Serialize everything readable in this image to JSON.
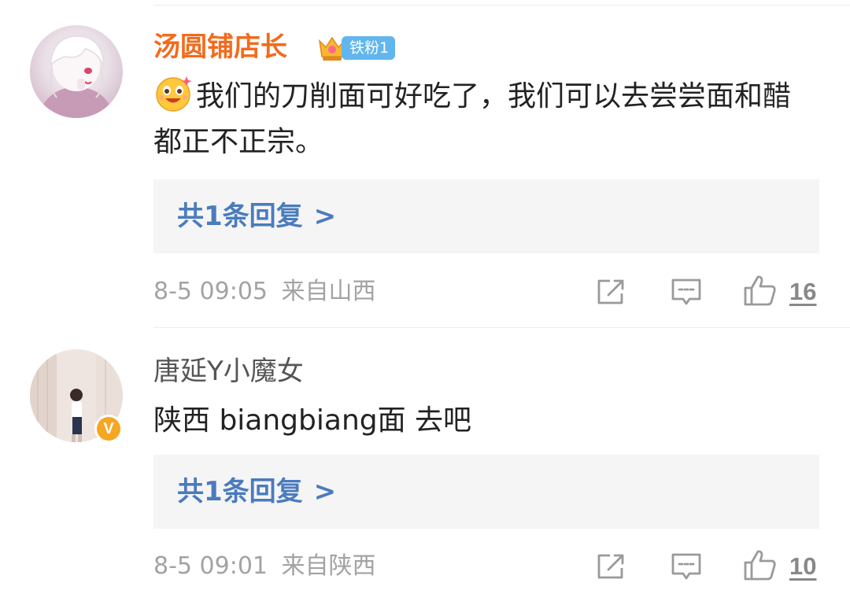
{
  "comments": [
    {
      "username": "汤圆铺店长",
      "fan_badge": "铁粉1",
      "content": "我们的刀削面可好吃了，我们可以去尝尝面和醋都正不正宗。",
      "reply_label": "共1条回复",
      "reply_chevron": ">",
      "timestamp": "8-5 09:05",
      "location": "来自山西",
      "like_count": "16",
      "icons": [
        "crown-icon",
        "emoji-icon",
        "share-icon",
        "comment-icon",
        "like-icon"
      ]
    },
    {
      "username": "唐延Y小魔女",
      "verified_mark": "V",
      "content": "陕西 biangbiang面 去吧",
      "reply_label": "共1条回复",
      "reply_chevron": ">",
      "timestamp": "8-5 09:01",
      "location": "来自陕西",
      "like_count": "10",
      "icons": [
        "verified-icon",
        "share-icon",
        "comment-icon",
        "like-icon"
      ]
    }
  ],
  "colors": {
    "username_vip": "#f26b1d",
    "username_normal": "#555555",
    "reply_link": "#4a7bbd",
    "reply_bg": "#f5f5f5",
    "meta_text": "#a3a3a3",
    "fan_badge_bg": "#62b6ee",
    "verified_badge_bg": "#f5a623"
  }
}
